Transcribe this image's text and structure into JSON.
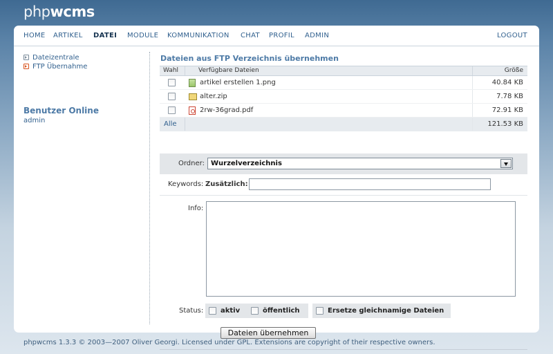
{
  "logo": {
    "light": "php",
    "bold": "wcms"
  },
  "nav": {
    "items": [
      {
        "label": "HOME"
      },
      {
        "label": "ARTIKEL"
      },
      {
        "label": "DATEI"
      },
      {
        "label": "MODULE"
      },
      {
        "label": "KOMMUNIKATION"
      },
      {
        "label": "CHAT"
      },
      {
        "label": "PROFIL"
      },
      {
        "label": "ADMIN"
      }
    ],
    "active": "DATEI",
    "logout": "LOGOUT"
  },
  "sidebar": {
    "links": [
      {
        "label": "Dateizentrale"
      },
      {
        "label": "FTP Übernahme"
      }
    ],
    "online_heading": "Benutzer Online",
    "online_user": "admin"
  },
  "content": {
    "title": "Dateien aus FTP Verzeichnis übernehmen",
    "table": {
      "headers": {
        "select": "Wahl",
        "files": "Verfügbare Dateien",
        "size": "Größe"
      },
      "rows": [
        {
          "name": "artikel erstellen 1.png",
          "size": "40.84 KB",
          "icon": "png-file-icon",
          "checked": false
        },
        {
          "name": "alter.zip",
          "size": "7.78 KB",
          "icon": "zip-file-icon",
          "checked": false
        },
        {
          "name": "2rw-36grad.pdf",
          "size": "72.91 KB",
          "icon": "pdf-file-icon",
          "checked": false
        }
      ],
      "all_label": "Alle",
      "total": "121.53 KB"
    },
    "folder": {
      "label": "Ordner:",
      "value": "Wurzelverzeichnis"
    },
    "keywords": {
      "label": "Keywords:",
      "sublabel": "Zusätzlich:",
      "value": ""
    },
    "info": {
      "label": "Info:",
      "value": ""
    },
    "status": {
      "label": "Status:",
      "options": [
        {
          "label": "aktiv",
          "checked": false
        },
        {
          "label": "öffentlich",
          "checked": false
        },
        {
          "label": "Ersetze gleichnamige Dateien",
          "checked": false
        }
      ]
    },
    "submit_label": "Dateien übernehmen"
  },
  "footer": "phpwcms 1.3.3 © 2003—2007 Oliver Georgi. Licensed under GPL. Extensions are copyright of their respective owners.",
  "colors": {
    "accent": "#31608e",
    "heading": "#4d7aa6",
    "active_bullet": "#d9541e"
  }
}
